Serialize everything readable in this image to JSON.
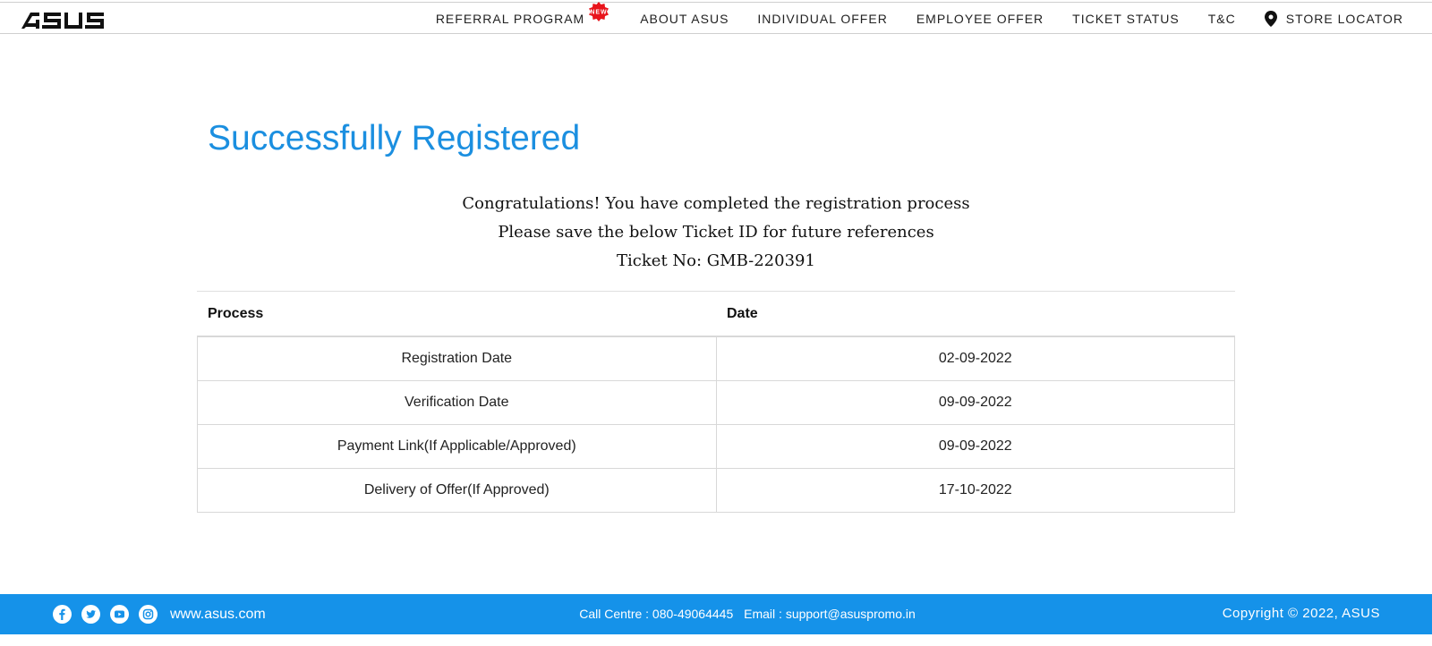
{
  "brand": {
    "logo_text": "ASUS",
    "accent": "#1b8fe0",
    "footer_bg": "#1592e9"
  },
  "nav": {
    "items": [
      {
        "label": "REFERRAL PROGRAM",
        "badge": "NEW"
      },
      {
        "label": "ABOUT ASUS"
      },
      {
        "label": "INDIVIDUAL OFFER"
      },
      {
        "label": "EMPLOYEE OFFER"
      },
      {
        "label": "TICKET STATUS"
      },
      {
        "label": "T&C"
      },
      {
        "label": "STORE LOCATOR",
        "icon": "location-pin-icon"
      }
    ]
  },
  "main": {
    "title": "Successfully Registered",
    "message_1": "Congratulations! You have completed the registration process",
    "message_2": "Please save the below Ticket ID for future references",
    "ticket": "Ticket No: GMB-220391"
  },
  "table": {
    "headers": [
      "Process",
      "Date"
    ],
    "rows": [
      [
        "Registration Date",
        "02-09-2022"
      ],
      [
        "Verification Date",
        "09-09-2022"
      ],
      [
        "Payment Link(If Applicable/Approved)",
        "09-09-2022"
      ],
      [
        "Delivery of Offer(If Approved)",
        "17-10-2022"
      ]
    ]
  },
  "footer": {
    "social_icons": [
      "facebook-icon",
      "twitter-icon",
      "youtube-icon",
      "instagram-icon"
    ],
    "website": "www.asus.com",
    "call_centre": "Call Centre : 080-49064445",
    "email": "Email : support@asuspromo.in",
    "copyright": "Copyright © 2022, ASUS"
  }
}
